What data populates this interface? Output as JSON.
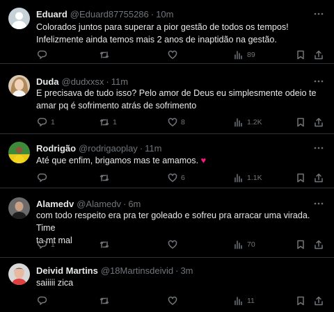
{
  "tweets": [
    {
      "name": "Eduard",
      "handle": "@Eduard87755286",
      "dot": "·",
      "time": "10m",
      "text_lines": [
        "Colorados juntos para superar a pior gestão de todos os tempos!",
        "Infelizmente ainda temos mais 2 anos de inaptidão na gestão."
      ],
      "replies": "",
      "retweets": "",
      "likes": "",
      "views": "89",
      "avatar": "default-avatar"
    },
    {
      "name": "Duda",
      "handle": "@dudxxsx",
      "dot": "·",
      "time": "11m",
      "text_lines": [
        "E precisava de tudo isso? Pelo amor de Deus eu simplesmente odeio te",
        "amar pq é sofrimento atrás de sofrimento"
      ],
      "replies": "1",
      "retweets": "1",
      "likes": "8",
      "views": "1.2K",
      "avatar": "photo-avatar"
    },
    {
      "name": "Rodrigão",
      "handle": "@rodrigaoplay",
      "dot": "·",
      "time": "11m",
      "text_lines": [
        "Até que enfim, brigamos mas te amamos."
      ],
      "emoji": "♥",
      "replies": "",
      "retweets": "",
      "likes": "6",
      "views": "1.1K",
      "avatar": "photo-avatar"
    },
    {
      "name": "Alamedv",
      "handle": "@Alamedv",
      "dot": "·",
      "time": "6m",
      "text_lines": [
        "com todo respeito era pra ter goleado e sofreu pra arracar uma virada. Time",
        "ta mt mal"
      ],
      "replies": "1",
      "retweets": "",
      "likes": "",
      "views": "70",
      "avatar": "photo-avatar"
    },
    {
      "name": "Deivid Martins",
      "handle": "@18Martinsdeivid",
      "dot": "·",
      "time": "3m",
      "text_lines": [
        "saiiiii zica"
      ],
      "replies": "",
      "retweets": "",
      "likes": "",
      "views": "11",
      "avatar": "photo-avatar"
    }
  ],
  "icons": {
    "reply": "reply-icon",
    "retweet": "retweet-icon",
    "like": "heart-icon",
    "views": "views-icon",
    "bookmark": "bookmark-icon",
    "share": "share-icon",
    "more": "more-icon"
  },
  "colors": {
    "background": "#000000",
    "text": "#e7e9ea",
    "muted": "#71767b",
    "divider": "#2f3336",
    "heart": "#f91880"
  }
}
